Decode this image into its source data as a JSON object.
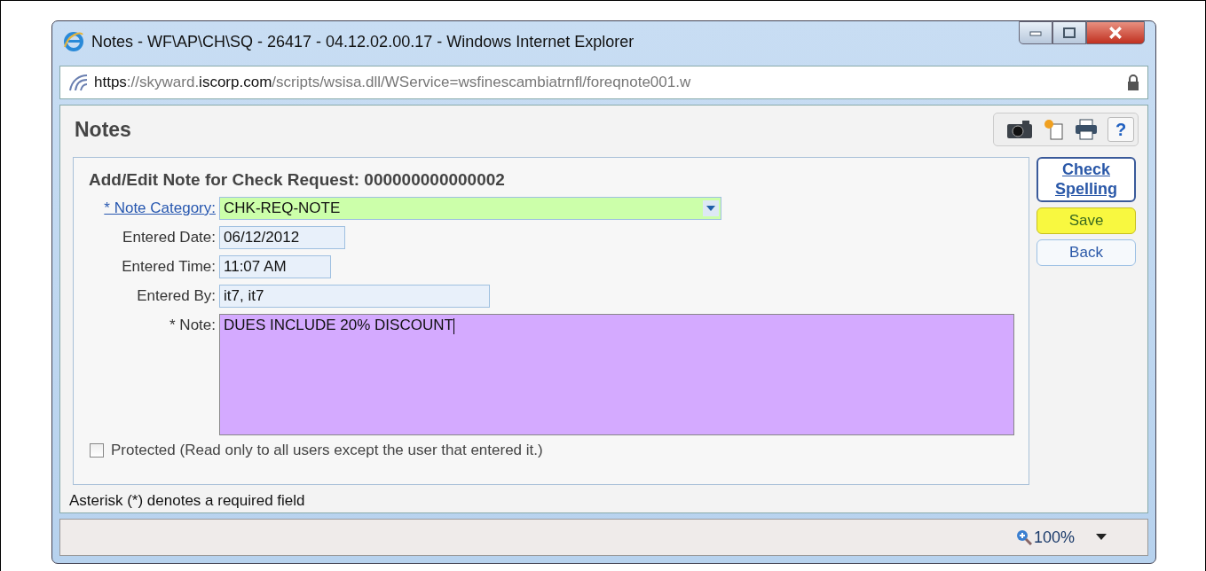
{
  "window": {
    "title": "Notes - WF\\AP\\CH\\SQ - 26417 - 04.12.02.00.17 - Windows Internet Explorer"
  },
  "address_bar": {
    "url_parts": [
      {
        "text": "https",
        "strong": true
      },
      {
        "text": "://skyward.",
        "strong": false
      },
      {
        "text": "iscorp.com",
        "strong": true
      },
      {
        "text": "/scripts/wsisa.dll/WService=wsfinescambiatrnfl/foreqnote001.w",
        "strong": false
      }
    ]
  },
  "page": {
    "heading": "Notes",
    "help": "?",
    "form": {
      "title": "Add/Edit Note for Check Request: 000000000000002",
      "fields": [
        {
          "kind": "dropdown",
          "label": "* Note Category:",
          "value": "CHK-REQ-NOTE"
        },
        {
          "kind": "text",
          "label": "Entered Date:",
          "value": "06/12/2012"
        },
        {
          "kind": "text",
          "label": "Entered Time:",
          "value": "11:07 AM"
        },
        {
          "kind": "text",
          "label": "Entered By:",
          "value": "it7, it7"
        },
        {
          "kind": "textarea",
          "label": "* Note:",
          "value": "DUES INCLUDE 20% DISCOUNT"
        }
      ],
      "protected": {
        "label": "Protected (Read only to all users except the user that entered it.)",
        "checked": false
      }
    },
    "buttons": [
      {
        "label": "Check Spelling",
        "kind": "link"
      },
      {
        "label": "Save",
        "kind": "highlight"
      },
      {
        "label": "Back",
        "kind": "plain"
      }
    ],
    "footnote": "Asterisk (*) denotes a required field"
  },
  "status_bar": {
    "zoom": "100%"
  }
}
